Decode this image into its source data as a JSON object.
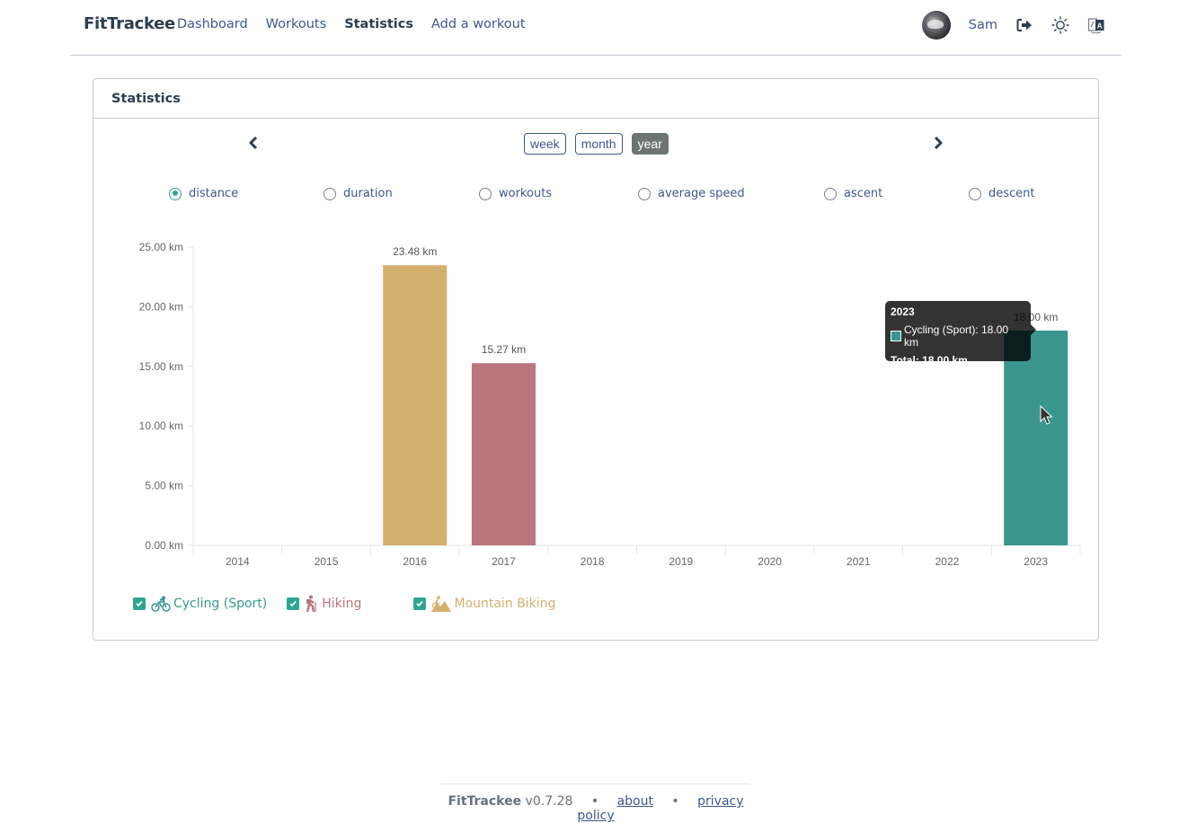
{
  "navbar": {
    "brand": "FitTrackee",
    "links": [
      {
        "label": "Dashboard",
        "active": false
      },
      {
        "label": "Workouts",
        "active": false
      },
      {
        "label": "Statistics",
        "active": true
      },
      {
        "label": "Add a workout",
        "active": false
      }
    ],
    "username": "Sam",
    "icons": [
      "avatar",
      "logout-icon",
      "sun-icon",
      "language-icon"
    ]
  },
  "card": {
    "title": "Statistics",
    "period_buttons": [
      {
        "label": "week",
        "active": false
      },
      {
        "label": "month",
        "active": false
      },
      {
        "label": "year",
        "active": true
      }
    ],
    "metrics": [
      {
        "label": "distance",
        "checked": true
      },
      {
        "label": "duration",
        "checked": false
      },
      {
        "label": "workouts",
        "checked": false
      },
      {
        "label": "average speed",
        "checked": false
      },
      {
        "label": "ascent",
        "checked": false
      },
      {
        "label": "descent",
        "checked": false
      }
    ]
  },
  "chart_data": {
    "type": "bar",
    "stacked": true,
    "title": "",
    "xlabel": "",
    "ylabel": "",
    "categories": [
      "2014",
      "2015",
      "2016",
      "2017",
      "2018",
      "2019",
      "2020",
      "2021",
      "2022",
      "2023"
    ],
    "series": [
      {
        "name": "Cycling (Sport)",
        "color": "#3a9790",
        "values": [
          0,
          0,
          0,
          0,
          0,
          0,
          0,
          0,
          0,
          18.0
        ]
      },
      {
        "name": "Hiking",
        "color": "#bb757c",
        "values": [
          0,
          0,
          0,
          15.27,
          0,
          0,
          0,
          0,
          0,
          0
        ]
      },
      {
        "name": "Mountain Biking",
        "color": "#d4b06f",
        "values": [
          0,
          0,
          23.48,
          0,
          0,
          0,
          0,
          0,
          0,
          0
        ]
      }
    ],
    "totals_labels": {
      "2016": "23.48 km",
      "2017": "15.27 km",
      "2023": "18.00 km"
    },
    "ylim": [
      0,
      25
    ],
    "yticks": [
      0,
      5,
      10,
      15,
      20,
      25
    ],
    "ytick_labels": [
      "0.00 km",
      "5.00 km",
      "10.00 km",
      "15.00 km",
      "20.00 km",
      "25.00 km"
    ],
    "grid": false,
    "legend": "bottom-left",
    "tooltip": {
      "title": "2023",
      "row": "Cycling (Sport): 18.00 km",
      "total": "Total: 18.00 km"
    }
  },
  "legend": [
    {
      "label": "Cycling (Sport)",
      "color": "#3a9790",
      "checked": true
    },
    {
      "label": "Hiking",
      "color": "#bb757c",
      "checked": true
    },
    {
      "label": "Mountain Biking",
      "color": "#d4b06f",
      "checked": true
    }
  ],
  "footer": {
    "brand": "FitTrackee",
    "version": "v0.7.28",
    "separator": "•",
    "about": "about",
    "privacy": "privacy policy"
  }
}
